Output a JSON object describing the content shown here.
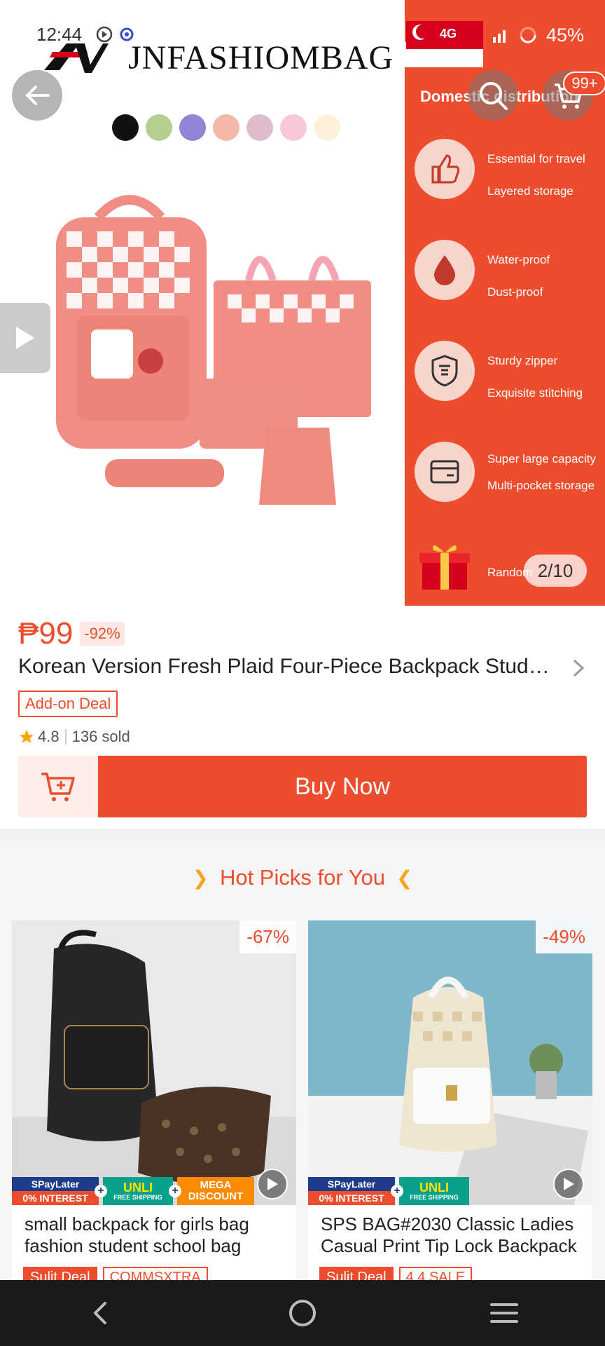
{
  "status_bar": {
    "time": "12:44",
    "battery": "45%",
    "network": "4G"
  },
  "hero": {
    "brand_name": "JNFASHIOMBAG",
    "swatch_colors": [
      "#111111",
      "#b5cf8e",
      "#8f84d6",
      "#f5b8a8",
      "#dfbccb",
      "#f9c8d6",
      "#fdf1dc"
    ],
    "feature_header": "Domestic distribution",
    "features": [
      {
        "icon": "thumbs-up-icon",
        "line1": "Essential for travel",
        "line2": "Layered storage"
      },
      {
        "icon": "water-drop-icon",
        "line1": "Water-proof",
        "line2": "Dust-proof"
      },
      {
        "icon": "quality-shield-icon",
        "line1": "Sturdy zipper",
        "line2": "Exquisite stitching"
      },
      {
        "icon": "wallet-card-icon",
        "line1": "Super large capacity",
        "line2": "Multi-pocket storage"
      },
      {
        "icon": "gift-box-icon",
        "line1": "Random",
        "line2": ""
      }
    ],
    "image_counter": "2/10",
    "cart_badge": "99+"
  },
  "product": {
    "price": "₱99",
    "discount": "-92%",
    "title": "Korean Version Fresh Plaid Four-Piece Backpack Student Schoolbag",
    "deal_tag": "Add-on Deal",
    "rating": "4.8",
    "sold": "136 sold",
    "buy_now_label": "Buy Now"
  },
  "hot_picks": {
    "heading": "Hot Picks for You",
    "items": [
      {
        "discount": "-67%",
        "title": "small backpack for girls bag fashion student school bag women",
        "promo": {
          "spay_top": "SPayLater",
          "spay_bottom": "0% INTEREST",
          "unli": "UNLI",
          "unli_sub": "FREE SHIPPING",
          "mega_1": "MEGA",
          "mega_2": "DISCOUNT"
        },
        "tags": [
          "Sulit Deal",
          "COMMSXTRA"
        ]
      },
      {
        "discount": "-49%",
        "title": "SPS BAG#2030 Classic Ladies Casual Print Tip Lock Backpack",
        "promo": {
          "spay_top": "SPayLater",
          "spay_bottom": "0% INTEREST",
          "unli": "UNLI",
          "unli_sub": "FREE SHIPPING"
        },
        "tags": [
          "Sulit Deal",
          "4.4 SALE"
        ]
      }
    ]
  },
  "colors": {
    "accent": "#ee4d2d",
    "accent_light": "#fdeee9",
    "star": "#f6a700"
  }
}
